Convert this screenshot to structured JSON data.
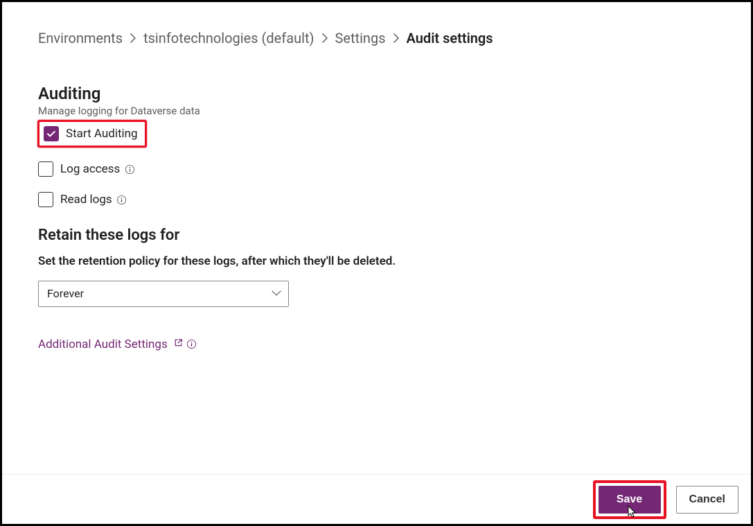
{
  "breadcrumb": {
    "items": [
      {
        "label": "Environments"
      },
      {
        "label": "tsinfotechnologies (default)"
      },
      {
        "label": "Settings"
      },
      {
        "label": "Audit settings"
      }
    ]
  },
  "auditing": {
    "title": "Auditing",
    "subtitle": "Manage logging for Dataverse data",
    "options": [
      {
        "label": "Start Auditing",
        "checked": true,
        "info": false
      },
      {
        "label": "Log access",
        "checked": false,
        "info": true
      },
      {
        "label": "Read logs",
        "checked": false,
        "info": true
      }
    ]
  },
  "retention": {
    "title": "Retain these logs for",
    "description": "Set the retention policy for these logs, after which they'll be deleted.",
    "selected": "Forever"
  },
  "link": {
    "label": "Additional Audit Settings"
  },
  "footer": {
    "save": "Save",
    "cancel": "Cancel"
  }
}
